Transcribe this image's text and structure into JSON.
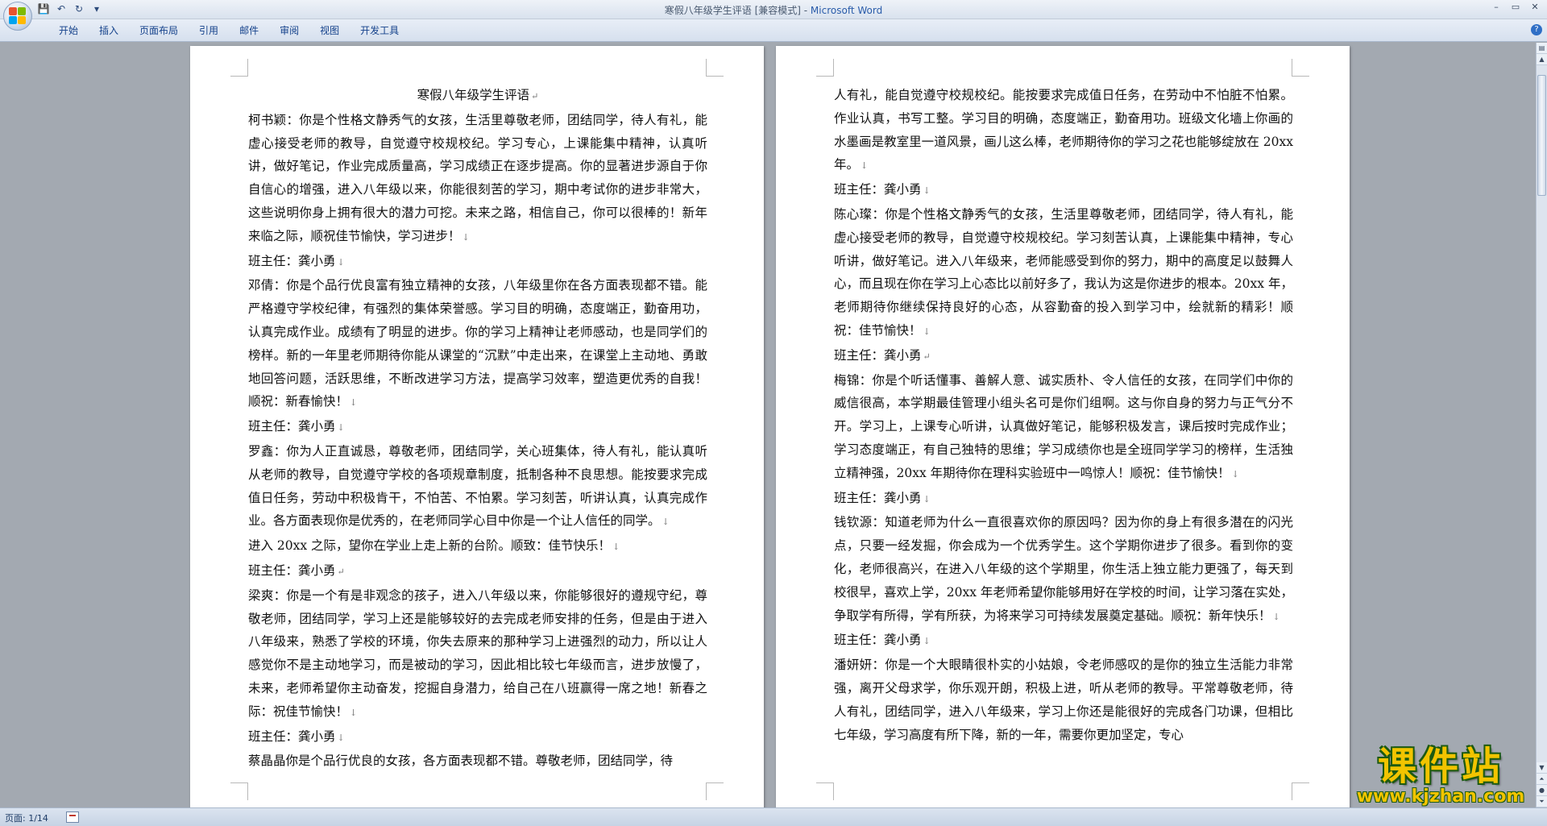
{
  "window": {
    "title_doc": "寒假八年级学生评语 [兼容模式] - ",
    "title_app": "Microsoft Word",
    "minimize": "–",
    "restore": "▭",
    "close": "✕"
  },
  "quick_access": {
    "save": "💾",
    "undo": "↶",
    "redo": "↻",
    "customize": "▾"
  },
  "ribbon": {
    "tabs": [
      "开始",
      "插入",
      "页面布局",
      "引用",
      "邮件",
      "审阅",
      "视图",
      "开发工具"
    ],
    "help": "?"
  },
  "left_page": {
    "title": "寒假八年级学生评语",
    "paragraphs": [
      "柯书颖：你是个性格文静秀气的女孩，生活里尊敬老师，团结同学，待人有礼，能虚心接受老师的教导，自觉遵守校规校纪。学习专心，上课能集中精神，认真听讲，做好笔记，作业完成质量高，学习成绩正在逐步提高。你的显著进步源自于你自信心的增强，进入八年级以来，你能很刻苦的学习，期中考试你的进步非常大，这些说明你身上拥有很大的潜力可挖。未来之路，相信自己，你可以很棒的！新年来临之际，顺祝佳节愉快，学习进步！",
      "班主任：龚小勇",
      "邓倩：你是个品行优良富有独立精神的女孩，八年级里你在各方面表现都不错。能严格遵守学校纪律，有强烈的集体荣誉感。学习目的明确，态度端正，勤奋用功，认真完成作业。成绩有了明显的进步。你的学习上精神让老师感动，也是同学们的榜样。新的一年里老师期待你能从课堂的“沉默”中走出来，在课堂上主动地、勇敢地回答问题，活跃思维，不断改进学习方法，提高学习效率，塑造更优秀的自我！顺祝：新春愉快！",
      "班主任：龚小勇",
      "罗鑫：你为人正直诚恳，尊敬老师，团结同学，关心班集体，待人有礼，能认真听从老师的教导，自觉遵守学校的各项规章制度，抵制各种不良思想。能按要求完成值日任务，劳动中积极肯干，不怕苦、不怕累。学习刻苦，听讲认真，认真完成作业。各方面表现你是优秀的，在老师同学心目中你是一个让人信任的同学。",
      "进入 20xx 之际，望你在学业上走上新的台阶。顺致：佳节快乐！",
      "班主任：龚小勇",
      "梁爽：你是一个有是非观念的孩子，进入八年级以来，你能够很好的遵规守纪，尊敬老师，团结同学，学习上还是能够较好的去完成老师安排的任务，但是由于进入八年级来，熟悉了学校的环境，你失去原来的那种学习上进强烈的动力，所以让人感觉你不是主动地学习，而是被动的学习，因此相比较七年级而言，进步放慢了，未来，老师希望你主动奋发，挖掘自身潜力，给自己在八班赢得一席之地！新春之际：祝佳节愉快！",
      "班主任：龚小勇",
      "蔡晶晶你是个品行优良的女孩，各方面表现都不错。尊敬老师，团结同学，待"
    ]
  },
  "right_page": {
    "paragraphs": [
      "人有礼，能自觉遵守校规校纪。能按要求完成值日任务，在劳动中不怕脏不怕累。作业认真，书写工整。学习目的明确，态度端正，勤奋用功。班级文化墙上你画的水墨画是教室里一道风景，画儿这么棒，老师期待你的学习之花也能够绽放在 20xx 年。",
      "班主任：龚小勇",
      "陈心璨：你是个性格文静秀气的女孩，生活里尊敬老师，团结同学，待人有礼，能虚心接受老师的教导，自觉遵守校规校纪。学习刻苦认真，上课能集中精神，专心听讲，做好笔记。进入八年级来，老师能感受到你的努力，期中的高度足以鼓舞人心，而且现在你在学习上心态比以前好多了，我认为这是你进步的根本。20xx 年，老师期待你继续保持良好的心态，从容勤奋的投入到学习中，绘就新的精彩！顺祝：佳节愉快！",
      "班主任：龚小勇",
      "梅锦：你是个听话懂事、善解人意、诚实质朴、令人信任的女孩，在同学们中你的威信很高，本学期最佳管理小组头名可是你们组啊。这与你自身的努力与正气分不开。学习上，上课专心听讲，认真做好笔记，能够积极发言，课后按时完成作业；学习态度端正，有自己独特的思维；学习成绩你也是全班同学学习的榜样，生活独立精神强，20xx 年期待你在理科实验班中一鸣惊人！顺祝：佳节愉快！",
      "班主任：龚小勇",
      "钱钦源：知道老师为什么一直很喜欢你的原因吗？因为你的身上有很多潜在的闪光点，只要一经发掘，你会成为一个优秀学生。这个学期你进步了很多。看到你的变化，老师很高兴，在进入八年级的这个学期里，你生活上独立能力更强了，每天到校很早，喜欢上学，20xx 年老师希望你能够用好在学校的时间，让学习落在实处，争取学有所得，学有所获，为将来学习可持续发展奠定基础。顺祝：新年快乐！",
      "班主任：龚小勇",
      "潘妍妍：你是一个大眼睛很朴实的小姑娘，令老师感叹的是你的独立生活能力非常强，离开父母求学，你乐观开朗，积极上进，听从老师的教导。平常尊敬老师，待人有礼，团结同学，进入八年级来，学习上你还是能很好的完成各门功课，但相比七年级，学习高度有所下降，新的一年，需要你更加坚定，专心"
    ]
  },
  "status_bar": {
    "page_info": "页面: 1/14"
  },
  "watermark": {
    "cn": "课件站",
    "url": "www.kjzhan.com"
  }
}
